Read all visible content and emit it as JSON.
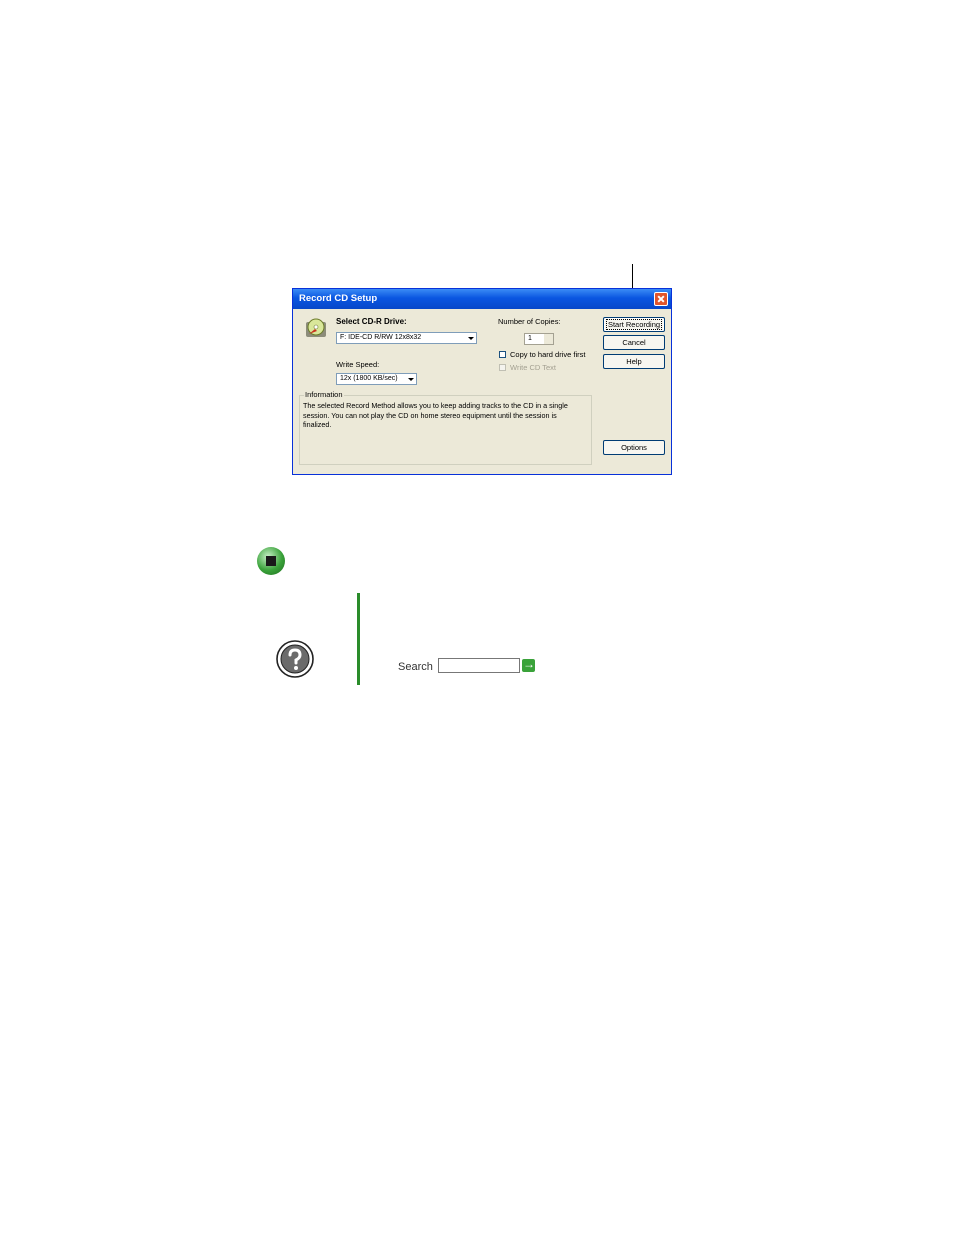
{
  "dialog": {
    "title": "Record CD Setup",
    "select_drive_label": "Select CD-R Drive:",
    "drive_value": "F: IDE-CD R/RW 12x8x32",
    "write_speed_label": "Write Speed:",
    "write_speed_value": "12x (1800 KB/sec)",
    "copies_label": "Number of Copies:",
    "copies_value": "1",
    "copy_to_hd_label": "Copy to hard drive first",
    "write_cd_text_label": "Write CD Text",
    "buttons": {
      "start": "Start Recording",
      "cancel": "Cancel",
      "help": "Help",
      "options": "Options"
    },
    "information": {
      "legend": "Information",
      "text": "The selected Record Method allows you to keep adding tracks to the CD in a single session. You can not play the CD on home stereo equipment until the session is finalized."
    }
  },
  "help_box": {
    "search_label": "Search",
    "search_value": ""
  },
  "colors": {
    "accent_green": "#2a8c2a",
    "titlebar_blue": "#0a56e1"
  },
  "icons": [
    "cd-burner-icon",
    "close-icon",
    "end-of-section-icon",
    "help-icon",
    "go-arrow-icon"
  ]
}
